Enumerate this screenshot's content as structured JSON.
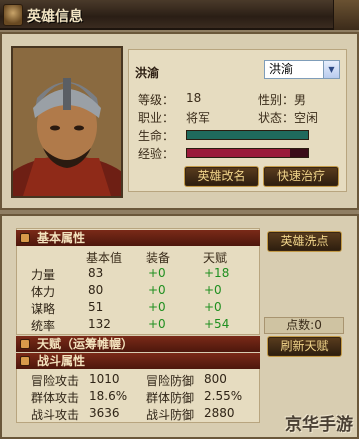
{
  "window": {
    "title": "英雄信息"
  },
  "hero": {
    "name": "洪渝",
    "select_value": "洪渝",
    "fields": {
      "level_label": "等级：",
      "level": "18",
      "gender_label": "性别：",
      "gender": "男",
      "job_label": "职业：",
      "job": "将军",
      "state_label": "状态：",
      "state": "空闲",
      "hp_label": "生命：",
      "hp_fraction": 1.0,
      "exp_label": "经验：",
      "exp_fraction": 0.85
    },
    "buttons": {
      "rename": "英雄改名",
      "heal": "快速治疗"
    }
  },
  "basic": {
    "header": "基本属性",
    "columns": [
      "基本值",
      "装备",
      "天赋"
    ],
    "rows": [
      {
        "name": "力量",
        "base": "83",
        "equip": "+0",
        "talent": "+18"
      },
      {
        "name": "体力",
        "base": "80",
        "equip": "+0",
        "talent": "+0"
      },
      {
        "name": "谋略",
        "base": "51",
        "equip": "+0",
        "talent": "+0"
      },
      {
        "name": "统率",
        "base": "132",
        "equip": "+0",
        "talent": "+54"
      }
    ],
    "wash_button": "英雄洗点",
    "points": "点数:0",
    "refresh_button": "刷新天赋"
  },
  "talent": {
    "header": "天赋（运筹帷幄）"
  },
  "combat": {
    "header": "战斗属性",
    "rows": [
      {
        "l1": "冒险攻击",
        "v1": "1010",
        "l2": "冒险防御",
        "v2": "800"
      },
      {
        "l1": "群体攻击",
        "v1": "18.6%",
        "l2": "群体防御",
        "v2": "2.55%"
      },
      {
        "l1": "战斗攻击",
        "v1": "3636",
        "l2": "战斗防御",
        "v2": "2880"
      }
    ]
  },
  "watermark": "京华手游",
  "colors": {
    "hp_bar": "#1f6a5c",
    "exp_bar": "#9a1a3a",
    "accent_gold": "#c29a47",
    "section_red": "#6a2312"
  }
}
